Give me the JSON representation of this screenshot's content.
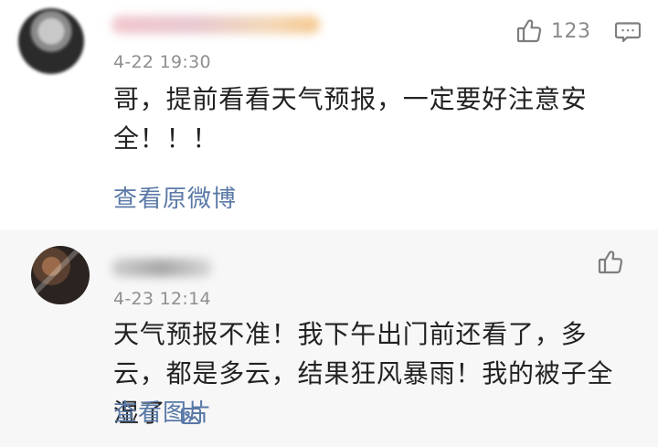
{
  "comments": [
    {
      "time": "4-22 19:30",
      "text": "哥，提前看看天气预报，一定要好注意安全！！！",
      "link": "查看原微博",
      "likes": "123"
    },
    {
      "time": "4-23 12:14",
      "text": "天气预报不准！我下午出门前还看了，多云，都是多云，结果狂风暴雨！我的被子全湿了",
      "link": "查看图片"
    }
  ],
  "icons": {
    "like": "thumbs-up-icon",
    "reply": "comment-icon",
    "image": "image-icon"
  },
  "colors": {
    "link": "#5a79a7",
    "secondary_bg": "#f7f7f7",
    "text": "#222222",
    "meta": "#8f8f8f"
  }
}
